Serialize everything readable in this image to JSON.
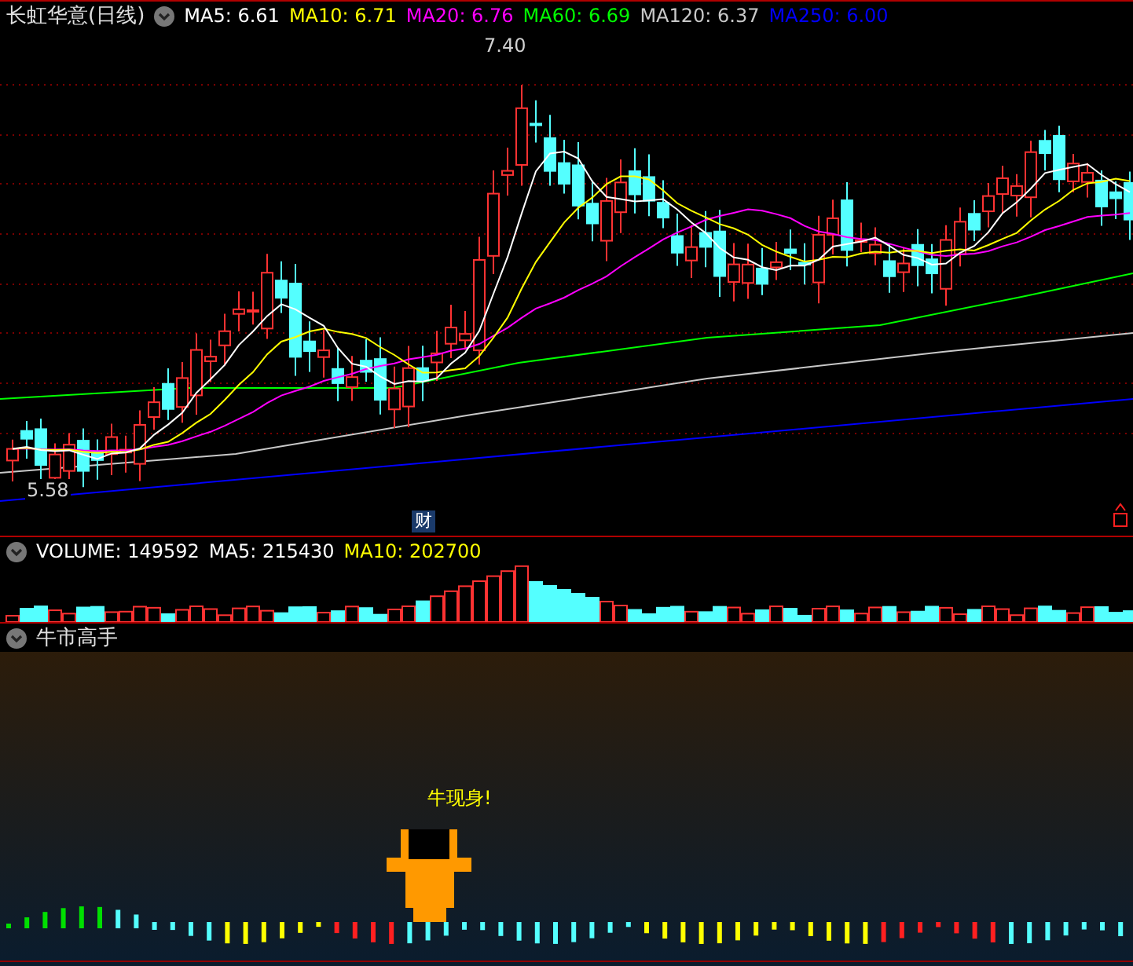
{
  "main_panel": {
    "title": "长虹华意(日线)",
    "indicators": [
      {
        "label": "MA5: 6.61",
        "color": "#ffffff"
      },
      {
        "label": "MA10: 6.71",
        "color": "#ffff00"
      },
      {
        "label": "MA20: 6.76",
        "color": "#ff00ff"
      },
      {
        "label": "MA60: 6.69",
        "color": "#00ff00"
      },
      {
        "label": "MA120: 6.37",
        "color": "#c8c8c8"
      },
      {
        "label": "MA250: 6.00",
        "color": "#0000ff"
      }
    ],
    "high_label": "7.40",
    "low_label": "5.58",
    "event_badge": "财"
  },
  "volume_panel": {
    "indicators": [
      {
        "label": "VOLUME: 149592",
        "color": "#ffffff"
      },
      {
        "label": "MA5: 215430",
        "color": "#ffffff"
      },
      {
        "label": "MA10: 202700",
        "color": "#ffff00"
      }
    ]
  },
  "signal_panel": {
    "title": "牛市高手",
    "signal_text": "牛现身!"
  }
}
